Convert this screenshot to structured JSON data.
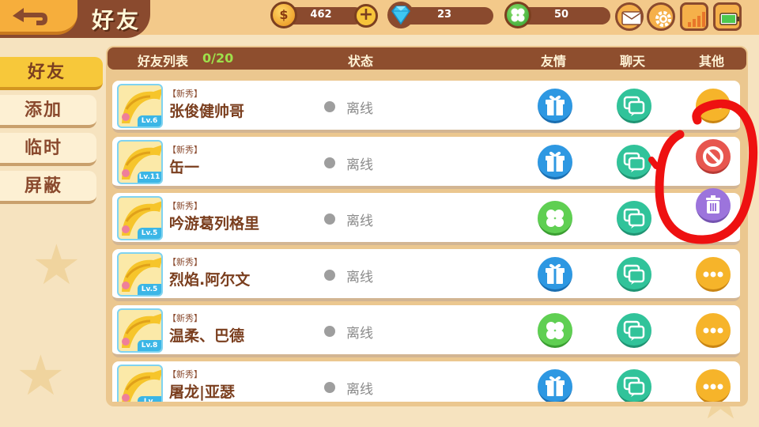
{
  "header": {
    "title": "好友",
    "coins": "462",
    "gems": "23",
    "clovers": "50",
    "icons": {
      "back": "back-arrow-icon",
      "coin": "coin-icon",
      "coin_symbol": "$",
      "plus": "plus-icon",
      "plus_symbol": "+",
      "gem": "gem-icon",
      "clover": "clover-icon",
      "mail": "mail-icon",
      "settings": "gear-icon",
      "signal": "signal-icon",
      "battery": "battery-icon"
    }
  },
  "sidebar": {
    "tabs": [
      {
        "label": "好友",
        "active": true
      },
      {
        "label": "添加",
        "active": false
      },
      {
        "label": "临时",
        "active": false
      },
      {
        "label": "屏蔽",
        "active": false
      }
    ]
  },
  "list_header": {
    "friend_list_label": "好友列表",
    "count": "0/20",
    "status_label": "状态",
    "friendship_label": "友情",
    "chat_label": "聊天",
    "other_label": "其他"
  },
  "friends": [
    {
      "tag": "【新秀】",
      "name": "张俊健帅哥",
      "level": "Lv.6",
      "status": "离线",
      "friendship_action": "gift"
    },
    {
      "tag": "【新秀】",
      "name": "缶一",
      "level": "Lv.11",
      "status": "离线",
      "friendship_action": "gift"
    },
    {
      "tag": "【新秀】",
      "name": "吟游葛列格里",
      "level": "Lv.5",
      "status": "离线",
      "friendship_action": "clover"
    },
    {
      "tag": "【新秀】",
      "name": "烈焰.阿尔文",
      "level": "Lv.5",
      "status": "离线",
      "friendship_action": "gift"
    },
    {
      "tag": "【新秀】",
      "name": "温柔、巴德",
      "level": "Lv.8",
      "status": "离线",
      "friendship_action": "clover"
    },
    {
      "tag": "【新秀】",
      "name": "屠龙|亚瑟",
      "level": "Lv.",
      "status": "离线",
      "friendship_action": "gift"
    }
  ],
  "popup_actions": [
    {
      "name": "block",
      "icon": "block-icon"
    },
    {
      "name": "delete",
      "icon": "trash-icon"
    }
  ],
  "colors": {
    "accent_yellow": "#f7c83a",
    "brown": "#8a4a2e",
    "gift_blue": "#2e98e2",
    "chat_green": "#31c39a",
    "more_orange": "#f6b42a",
    "ban_red": "#e7564f",
    "delete_purple": "#9c74dc",
    "annotation_red": "#ee1111"
  }
}
